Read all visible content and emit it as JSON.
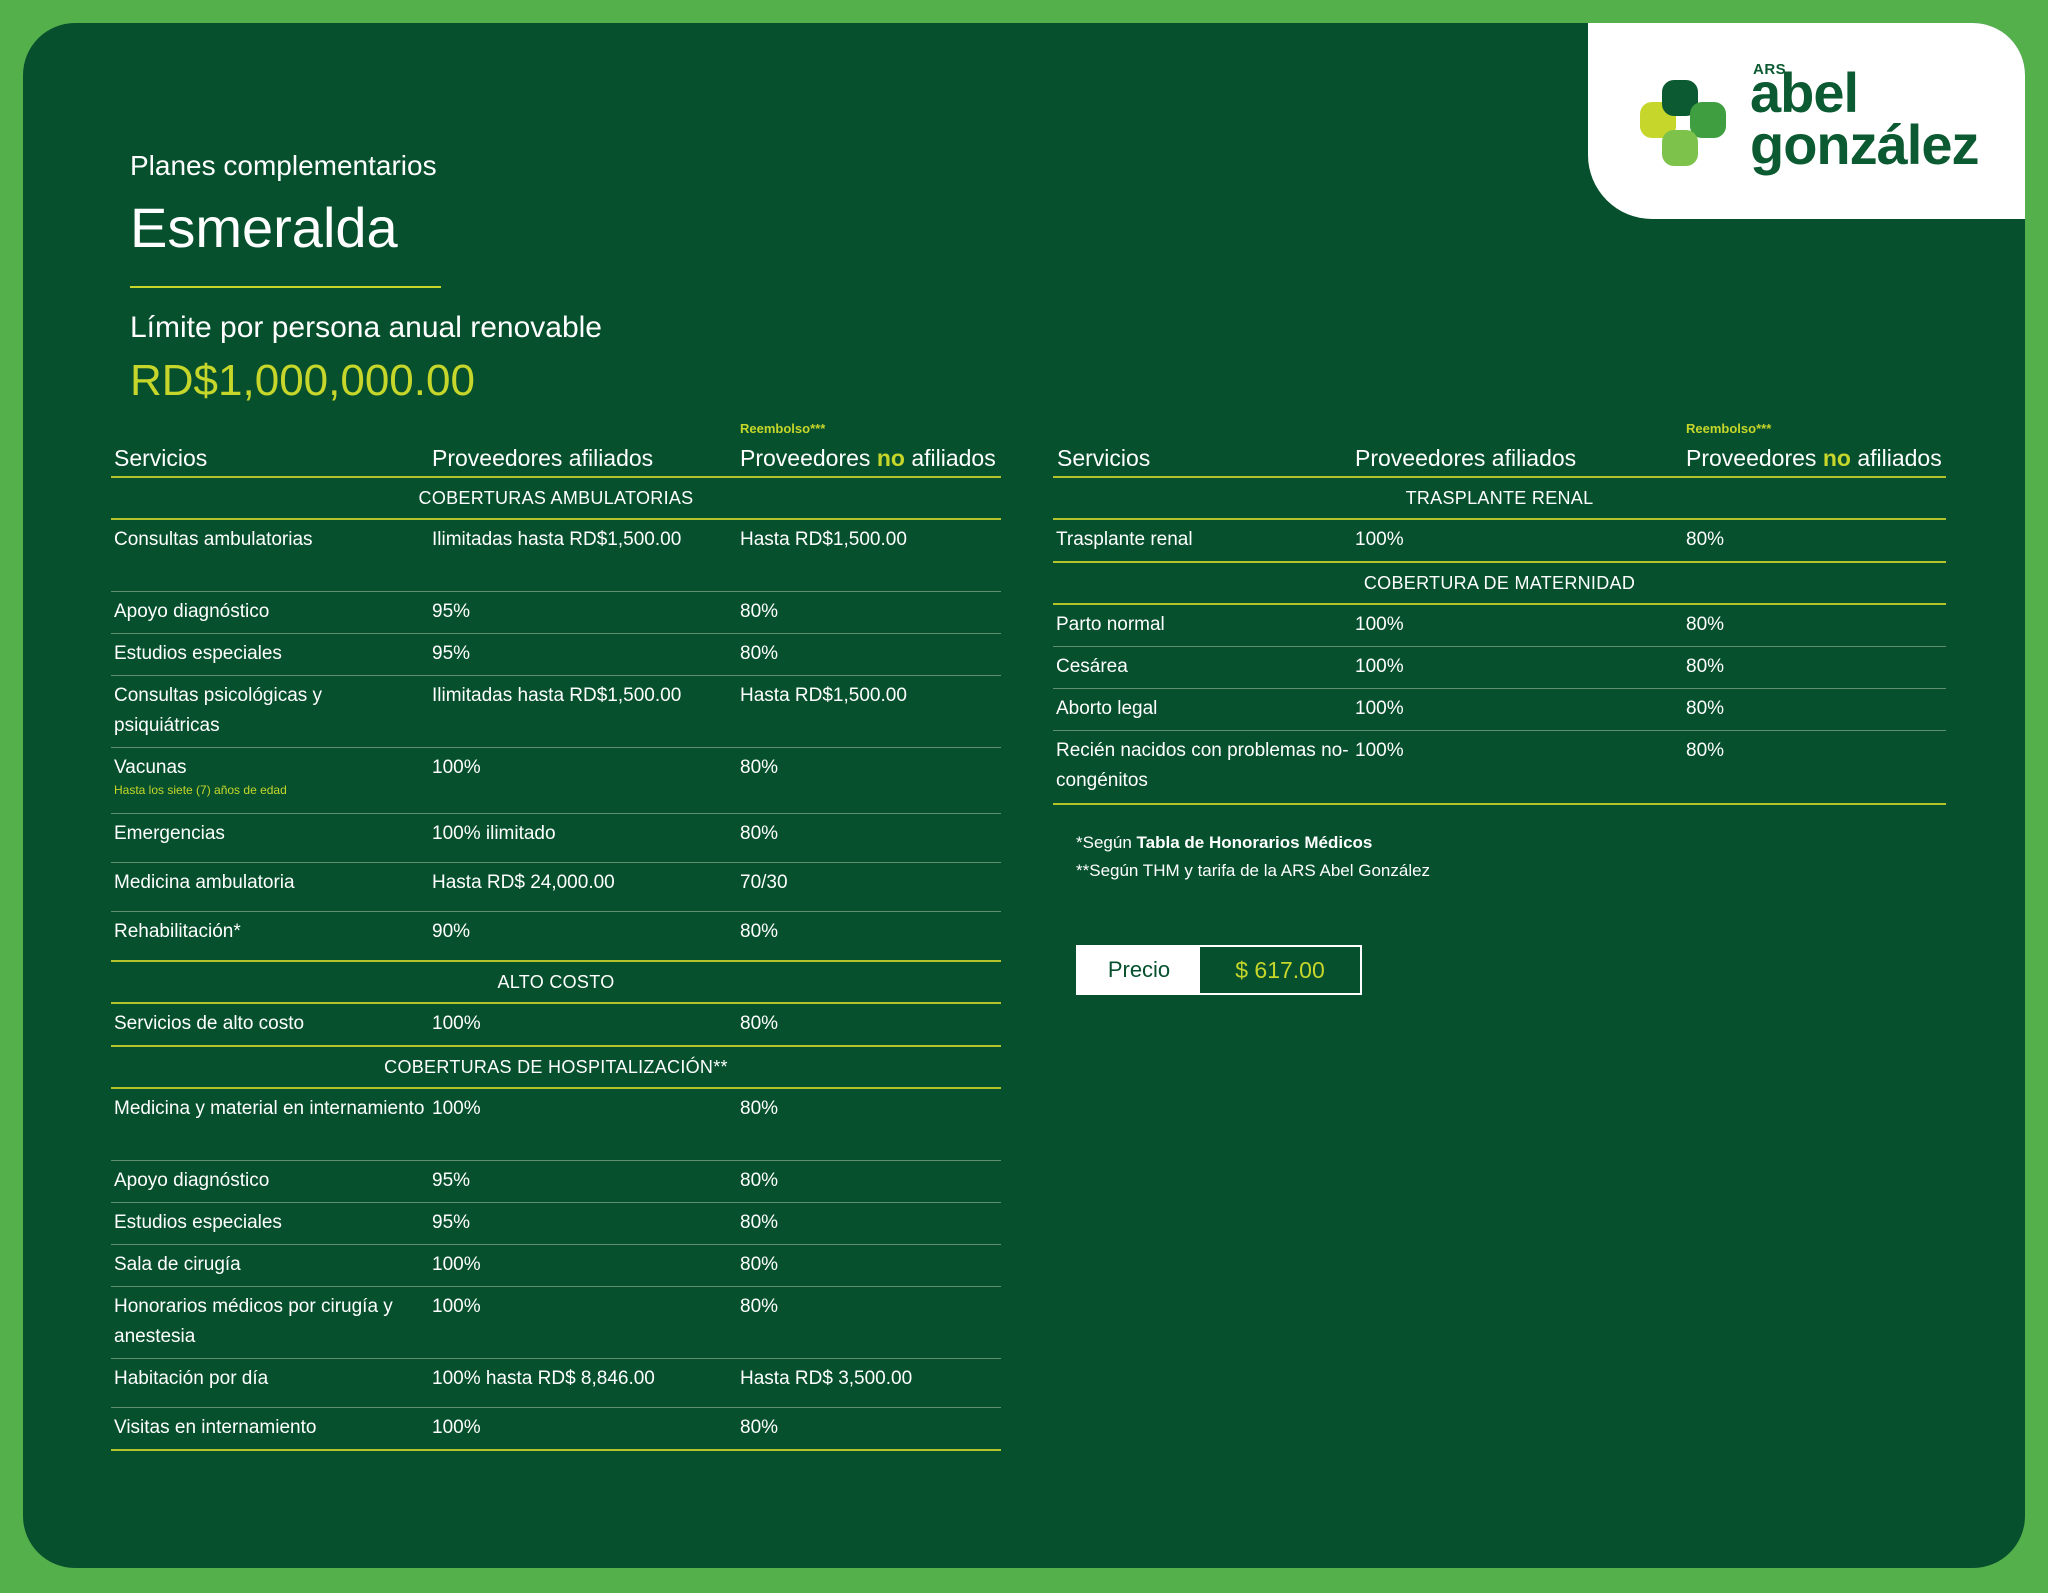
{
  "brand": {
    "ars": "ARS",
    "name_line1": "abel",
    "name_line2": "gonzález"
  },
  "header": {
    "eyebrow": "Planes complementarios",
    "plan_name": "Esmeralda",
    "limit_label": "Límite por persona anual renovable",
    "limit_value": "RD$1,000,000.00"
  },
  "table_headers": {
    "reimbursement_tag": "Reembolso***",
    "col_service": "Servicios",
    "col_affiliated": "Proveedores afiliados",
    "col_non_pre": "Proveedores",
    "col_non_highlight": "no",
    "col_non_post": "afiliados"
  },
  "left_table": {
    "sections": [
      {
        "title": "COBERTURAS AMBULATORIAS",
        "rows": [
          {
            "service": "Consultas ambulatorias",
            "affiliated": "Ilimitadas hasta RD$1,500.00",
            "non_affiliated": "Hasta RD$1,500.00"
          },
          {
            "service": "Apoyo diagnóstico",
            "affiliated": "95%",
            "non_affiliated": "80%"
          },
          {
            "service": "Estudios especiales",
            "affiliated": "95%",
            "non_affiliated": "80%"
          },
          {
            "service": "Consultas psicológicas y psiquiátricas",
            "affiliated": "Ilimitadas hasta RD$1,500.00",
            "non_affiliated": "Hasta RD$1,500.00"
          },
          {
            "service": "Vacunas",
            "note": "Hasta los siete (7) años de edad",
            "affiliated": "100%",
            "non_affiliated": "80%"
          },
          {
            "service": "Emergencias",
            "affiliated": "100% ilimitado",
            "non_affiliated": "80%"
          },
          {
            "service": "Medicina ambulatoria",
            "affiliated": "Hasta RD$ 24,000.00",
            "non_affiliated": "70/30"
          },
          {
            "service": "Rehabilitación*",
            "affiliated": "90%",
            "non_affiliated": "80%"
          }
        ]
      },
      {
        "title": "ALTO COSTO",
        "rows": [
          {
            "service": "Servicios de alto costo",
            "affiliated": "100%",
            "non_affiliated": "80%"
          }
        ]
      },
      {
        "title": "COBERTURAS DE HOSPITALIZACIÓN**",
        "rows": [
          {
            "service": "Medicina y material en internamiento",
            "affiliated": "100%",
            "non_affiliated": "80%"
          },
          {
            "service": "Apoyo diagnóstico",
            "affiliated": "95%",
            "non_affiliated": "80%"
          },
          {
            "service": "Estudios especiales",
            "affiliated": "95%",
            "non_affiliated": "80%"
          },
          {
            "service": "Sala de cirugía",
            "affiliated": "100%",
            "non_affiliated": "80%"
          },
          {
            "service": "Honorarios médicos por cirugía y anestesia",
            "affiliated": "100%",
            "non_affiliated": "80%"
          },
          {
            "service": "Habitación por día",
            "affiliated": "100% hasta RD$ 8,846.00",
            "non_affiliated": "Hasta RD$ 3,500.00"
          },
          {
            "service": "Visitas en internamiento",
            "affiliated": "100%",
            "non_affiliated": "80%"
          }
        ]
      }
    ]
  },
  "right_table": {
    "sections": [
      {
        "title": "TRASPLANTE RENAL",
        "rows": [
          {
            "service": "Trasplante renal",
            "affiliated": "100%",
            "non_affiliated": "80%"
          }
        ]
      },
      {
        "title": "COBERTURA DE MATERNIDAD",
        "rows": [
          {
            "service": "Parto normal",
            "affiliated": "100%",
            "non_affiliated": "80%"
          },
          {
            "service": "Cesárea",
            "affiliated": "100%",
            "non_affiliated": "80%"
          },
          {
            "service": "Aborto legal",
            "affiliated": "100%",
            "non_affiliated": "80%"
          },
          {
            "service": "Recién nacidos con problemas no-congénitos",
            "affiliated": "100%",
            "non_affiliated": "80%"
          }
        ]
      }
    ]
  },
  "footnotes": {
    "fn1_pre": "*Según",
    "fn1_bold": "Tabla de Honorarios Médicos",
    "fn2": "**Según THM y tarifa de la ARS Abel González"
  },
  "price": {
    "label": "Precio",
    "value": "$ 617.00"
  },
  "colors": {
    "background": "#06502d",
    "accent": "#c6d62a",
    "frame": "#54b04a"
  }
}
